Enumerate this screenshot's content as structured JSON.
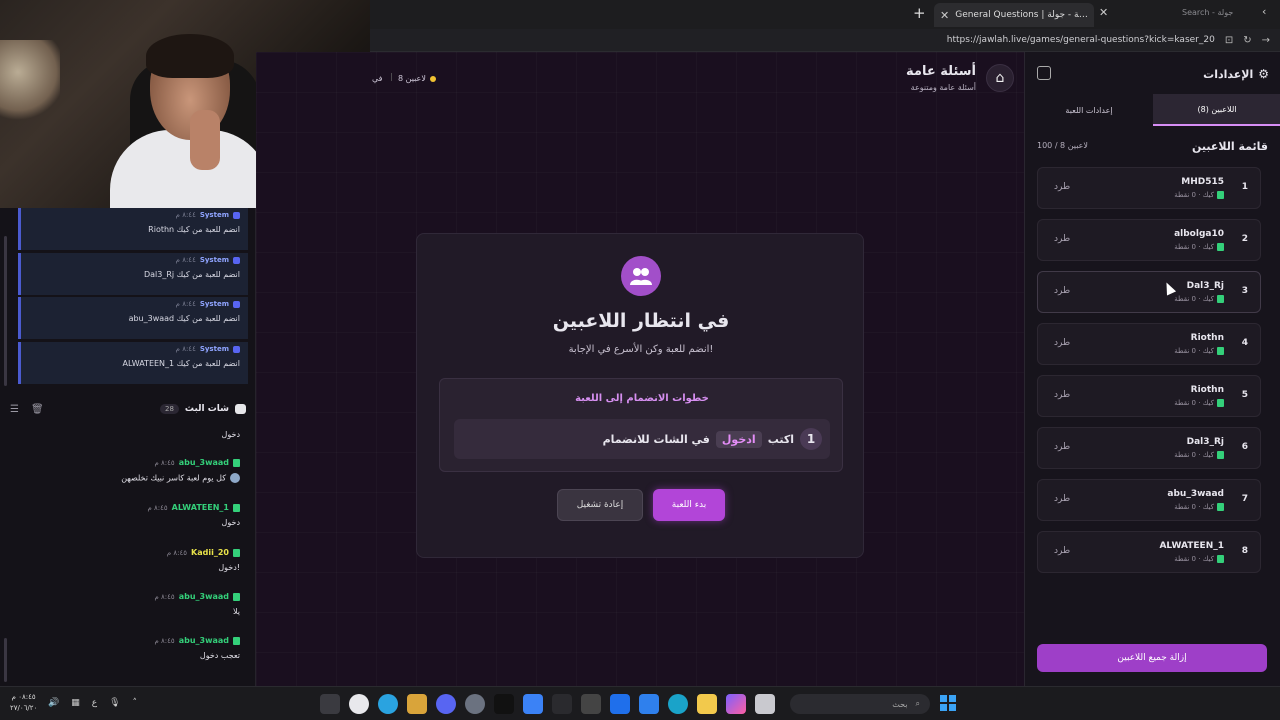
{
  "browser": {
    "tab_title": "General Questions | أسئلة عامة - جولة",
    "tab_search": "Search - جولة",
    "url": "https://jawlah.live/games/general-questions?kick=kaser_20"
  },
  "chat": {
    "system_messages": [
      {
        "name": "System",
        "time": "٨:٤٤ م",
        "text": "Riothn انضم للعبة من كيك"
      },
      {
        "name": "System",
        "time": "٨:٤٤ م",
        "text": "Dal3_Rj انضم للعبة من كيك"
      },
      {
        "name": "System",
        "time": "٨:٤٤ م",
        "text": "abu_3waad انضم للعبة من كيك"
      },
      {
        "name": "System",
        "time": "٨:٤٤ م",
        "text": "ALWATEEN_1 انضم للعبة من كيك"
      }
    ],
    "title": "شات البث",
    "count": "28",
    "first_text": "دخول",
    "messages": [
      {
        "user": "abu_3waad",
        "time": "٨:٤٥ م",
        "text": "كل يوم لعبة كاسر نبيك تخلصهن",
        "color": "#34d07a"
      },
      {
        "user": "ALWATEEN_1",
        "time": "٨:٤٥ م",
        "text": "دخول",
        "color": "#34d07a"
      },
      {
        "user": "Kadii_20",
        "time": "٨:٤٥ م",
        "text": "دخول!",
        "color": "#e9e34a"
      },
      {
        "user": "abu_3waad",
        "time": "٨:٤٥ م",
        "text": "يلا",
        "color": "#34d07a"
      },
      {
        "user": "abu_3waad",
        "time": "٨:٤٥ م",
        "text": "تعجب دخول",
        "color": "#34d07a"
      }
    ]
  },
  "game": {
    "title": "أسئلة عامة",
    "subtitle": "أسئلة عامة ومتنوعة",
    "players_pill": "8 لاعبين",
    "pill_cut": "في",
    "wait_title": "في انتظار اللاعبين",
    "wait_sub": "انضم للعبة وكن الأسرع في الإجابة!",
    "steps_title": "خطوات الانضمام إلى اللعبة",
    "step_number": "1",
    "step_prefix": "اكتب",
    "step_code": "ادخول",
    "step_suffix": "في الشات للانضمام",
    "start_label": "بدء اللعبة",
    "reset_label": "إعادة تشغيل"
  },
  "settings": {
    "title": "الإعدادات",
    "tab_players": "اللاعبين (8)",
    "tab_game": "إعدادات اللعبة",
    "list_title": "قائمة اللاعبين",
    "list_count": "100 / 8 لاعبين",
    "kick_label": "طرد",
    "meta_label": "كيك · 0 نقطة",
    "players": [
      {
        "num": "1",
        "name": "MHD515"
      },
      {
        "num": "2",
        "name": "albolga10"
      },
      {
        "num": "3",
        "name": "Dal3_Rj"
      },
      {
        "num": "4",
        "name": "Riothn"
      },
      {
        "num": "5",
        "name": "Riothn"
      },
      {
        "num": "6",
        "name": "Dal3_Rj"
      },
      {
        "num": "7",
        "name": "abu_3waad"
      },
      {
        "num": "8",
        "name": "ALWATEEN_1"
      }
    ],
    "remove_all": "إزالة جميع اللاعبين"
  },
  "taskbar": {
    "time": "٠٨:٤٥ م",
    "date": "٢٧/٠٦/٢٠",
    "lang": "ع",
    "search": "بحث"
  },
  "colors": {
    "accent": "#b245d8",
    "panel": "#17141c",
    "main_bg": "#1a0f1f"
  }
}
